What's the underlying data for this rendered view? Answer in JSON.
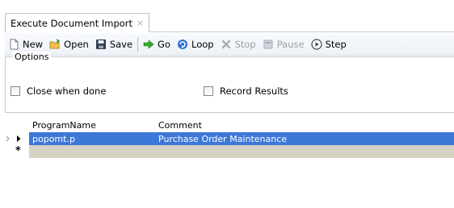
{
  "tab": {
    "title": "Execute Document Import",
    "close": "×"
  },
  "toolbar": {
    "new": "New",
    "open": "Open",
    "save": "Save",
    "go": "Go",
    "loop": "Loop",
    "stop": "Stop",
    "pause": "Pause",
    "step": "Step"
  },
  "options": {
    "legend": "Options",
    "close_when_done": "Close when done",
    "record_results": "Record Results"
  },
  "grid": {
    "columns": [
      "ProgramName",
      "Comment"
    ],
    "rows": [
      {
        "program": "popomt.p",
        "comment": "Purchase Order Maintenance"
      }
    ],
    "new_row_marker": "*"
  },
  "colors": {
    "selection": "#3d78d8",
    "new_row": "#d6d2c4",
    "go_icon": "#2eae2e",
    "loop_icon": "#2b6fd6"
  }
}
